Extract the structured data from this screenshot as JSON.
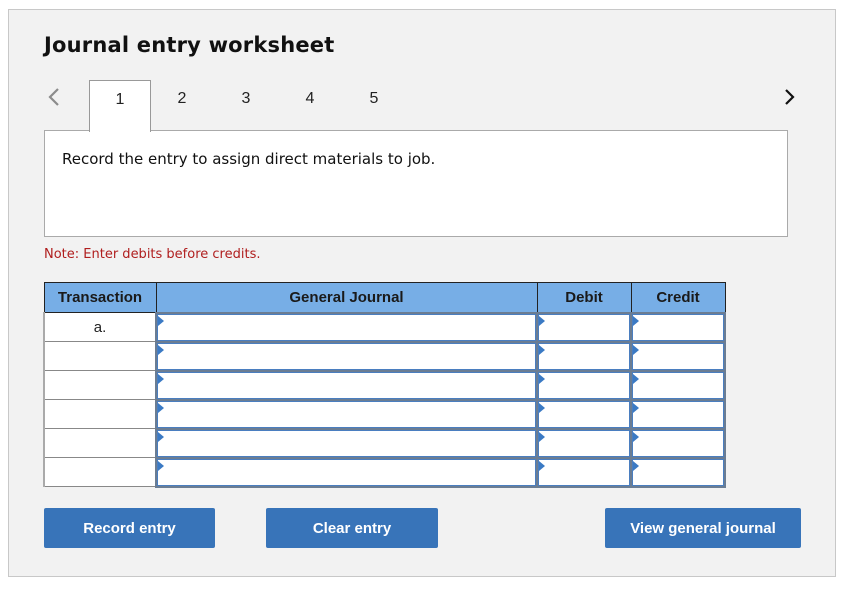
{
  "title": "Journal entry worksheet",
  "navigation": {
    "prev_icon": "chevron-left-icon",
    "next_icon": "chevron-right-icon",
    "tabs": [
      {
        "label": "1",
        "active": true
      },
      {
        "label": "2",
        "active": false
      },
      {
        "label": "3",
        "active": false
      },
      {
        "label": "4",
        "active": false
      },
      {
        "label": "5",
        "active": false
      }
    ]
  },
  "prompt": "Record the entry to assign direct materials to job.",
  "note": "Note: Enter debits before credits.",
  "table": {
    "headers": {
      "transaction": "Transaction",
      "journal": "General Journal",
      "debit": "Debit",
      "credit": "Credit"
    },
    "rows": [
      {
        "transaction": "a.",
        "journal": "",
        "debit": "",
        "credit": ""
      },
      {
        "transaction": "",
        "journal": "",
        "debit": "",
        "credit": ""
      },
      {
        "transaction": "",
        "journal": "",
        "debit": "",
        "credit": ""
      },
      {
        "transaction": "",
        "journal": "",
        "debit": "",
        "credit": ""
      },
      {
        "transaction": "",
        "journal": "",
        "debit": "",
        "credit": ""
      },
      {
        "transaction": "",
        "journal": "",
        "debit": "",
        "credit": ""
      }
    ]
  },
  "buttons": {
    "record": "Record entry",
    "clear": "Clear entry",
    "view": "View general journal"
  },
  "colors": {
    "header_bg": "#77aee6",
    "button_bg": "#3874b9",
    "note_color": "#b01e1e",
    "input_marker": "#3b7ac4"
  }
}
